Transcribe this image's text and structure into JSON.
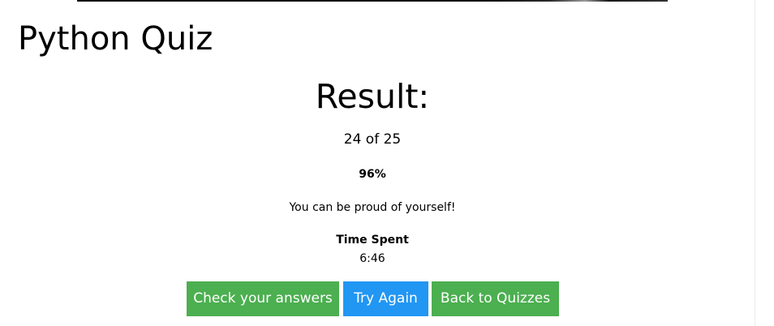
{
  "page": {
    "title": "Python Quiz"
  },
  "result": {
    "heading": "Result:",
    "score_text": "24 of 25",
    "percent_text": "96%",
    "message": "You can be proud of yourself!",
    "time_label": "Time Spent",
    "time_value": "6:46"
  },
  "actions": {
    "check_answers_label": "Check your answers",
    "try_again_label": "Try Again",
    "back_label": "Back to Quizzes"
  },
  "colors": {
    "green_button": "#4caf50",
    "blue_button": "#2196f3",
    "text": "#000000",
    "background": "#ffffff"
  }
}
